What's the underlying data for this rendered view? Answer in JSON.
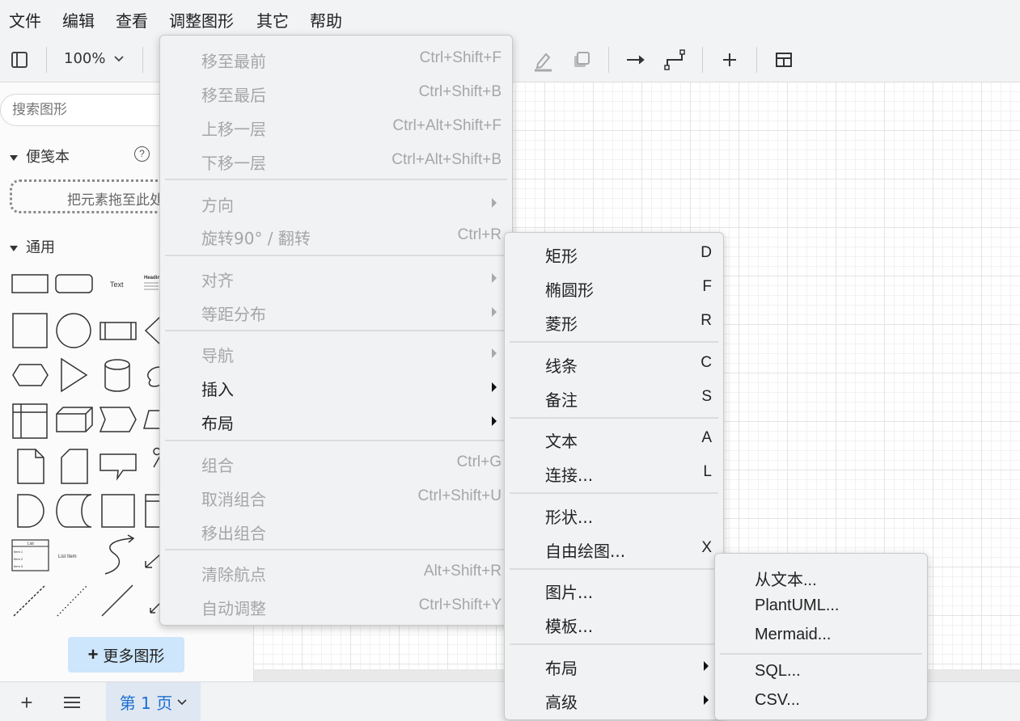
{
  "menubar": {
    "items": [
      "文件",
      "编辑",
      "查看",
      "调整图形",
      "其它",
      "帮助"
    ]
  },
  "toolbar": {
    "zoom": "100%",
    "icons": [
      "format-panel-icon",
      "edit-style-icon",
      "shadow-icon",
      "connection-arrow-icon",
      "waypoint-icon",
      "insert-plus-icon",
      "table-icon"
    ]
  },
  "sidebar": {
    "search_placeholder": "搜索图形",
    "scratchpad_title": "便笺本",
    "scratchpad_help": "?",
    "dropzone_text": "把元素拖至此处",
    "general_title": "通用",
    "shape_text_label": "Text",
    "shape_heading_label": "Headin",
    "shape_list_label": "List",
    "shape_list_items": [
      "Item 1",
      "Item 2",
      "Item 3"
    ],
    "shape_list_item_label": "List Item",
    "more_shapes": "更多图形",
    "more_shapes_icon": "+"
  },
  "arrange_menu": {
    "items": [
      {
        "label": "移至最前",
        "shortcut": "Ctrl+Shift+F"
      },
      {
        "label": "移至最后",
        "shortcut": "Ctrl+Shift+B"
      },
      {
        "label": "上移一层",
        "shortcut": "Ctrl+Alt+Shift+F"
      },
      {
        "label": "下移一层",
        "shortcut": "Ctrl+Alt+Shift+B"
      },
      {
        "label": "方向"
      },
      {
        "label": "旋转90° / 翻转",
        "shortcut": "Ctrl+R"
      },
      {
        "label": "对齐"
      },
      {
        "label": "等距分布"
      },
      {
        "label": "导航"
      },
      {
        "label": "插入"
      },
      {
        "label": "布局"
      },
      {
        "label": "组合",
        "shortcut": "Ctrl+G"
      },
      {
        "label": "取消组合",
        "shortcut": "Ctrl+Shift+U"
      },
      {
        "label": "移出组合"
      },
      {
        "label": "清除航点",
        "shortcut": "Alt+Shift+R"
      },
      {
        "label": "自动调整",
        "shortcut": "Ctrl+Shift+Y"
      }
    ]
  },
  "insert_menu": {
    "items": [
      {
        "label": "矩形",
        "shortcut": "D"
      },
      {
        "label": "椭圆形",
        "shortcut": "F"
      },
      {
        "label": "菱形",
        "shortcut": "R"
      },
      {
        "label": "线条",
        "shortcut": "C"
      },
      {
        "label": "备注",
        "shortcut": "S"
      },
      {
        "label": "文本",
        "shortcut": "A"
      },
      {
        "label": "连接...",
        "shortcut": "L"
      },
      {
        "label": "形状..."
      },
      {
        "label": "自由绘图...",
        "shortcut": "X"
      },
      {
        "label": "图片..."
      },
      {
        "label": "模板..."
      },
      {
        "label": "布局"
      },
      {
        "label": "高级"
      }
    ]
  },
  "advanced_menu": {
    "items": [
      {
        "label": "从文本..."
      },
      {
        "label": "PlantUML..."
      },
      {
        "label": "Mermaid..."
      },
      {
        "label": "SQL..."
      },
      {
        "label": "CSV..."
      }
    ]
  },
  "bottombar": {
    "add_page": "+",
    "page_tab": "第 1 页"
  }
}
